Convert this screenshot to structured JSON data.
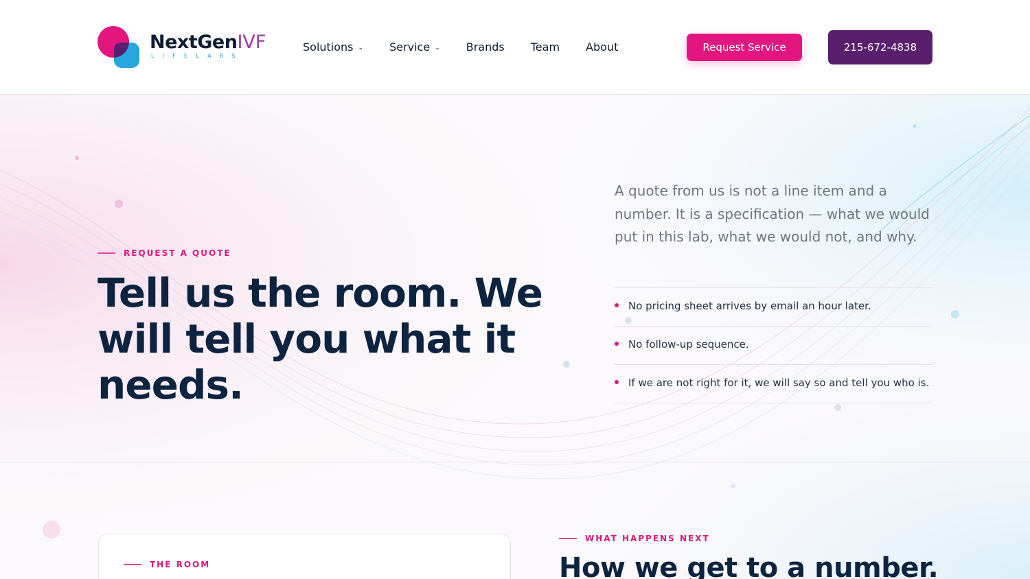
{
  "brand": {
    "name_main": "NextGen",
    "name_accent": "IVF",
    "tagline": "LIFELABS",
    "colors": {
      "pink": "#e3157f",
      "purple": "#5a1e6e",
      "blue": "#27a6e0",
      "navy": "#0c2440"
    }
  },
  "nav": {
    "items": [
      {
        "label": "Solutions",
        "has_dropdown": true
      },
      {
        "label": "Service",
        "has_dropdown": true
      },
      {
        "label": "Brands",
        "has_dropdown": false
      },
      {
        "label": "Team",
        "has_dropdown": false
      },
      {
        "label": "About",
        "has_dropdown": false
      }
    ],
    "chevron": "⌄",
    "request_button": "Request Service",
    "phone_button": "215-672-4838"
  },
  "hero": {
    "eyebrow": "REQUEST A QUOTE",
    "title": "Tell us the room. We will tell you what it needs.",
    "lead": "A quote from us is not a line item and a number. It is a specification — what we would put in this lab, what we would not, and why.",
    "points": [
      "No pricing sheet arrives by email an hour later.",
      "No follow-up sequence.",
      "If we are not right for it, we will say so and tell you who is."
    ]
  },
  "room": {
    "eyebrow": "THE ROOM"
  },
  "next": {
    "eyebrow": "WHAT HAPPENS NEXT",
    "title": "How we get to a number."
  }
}
